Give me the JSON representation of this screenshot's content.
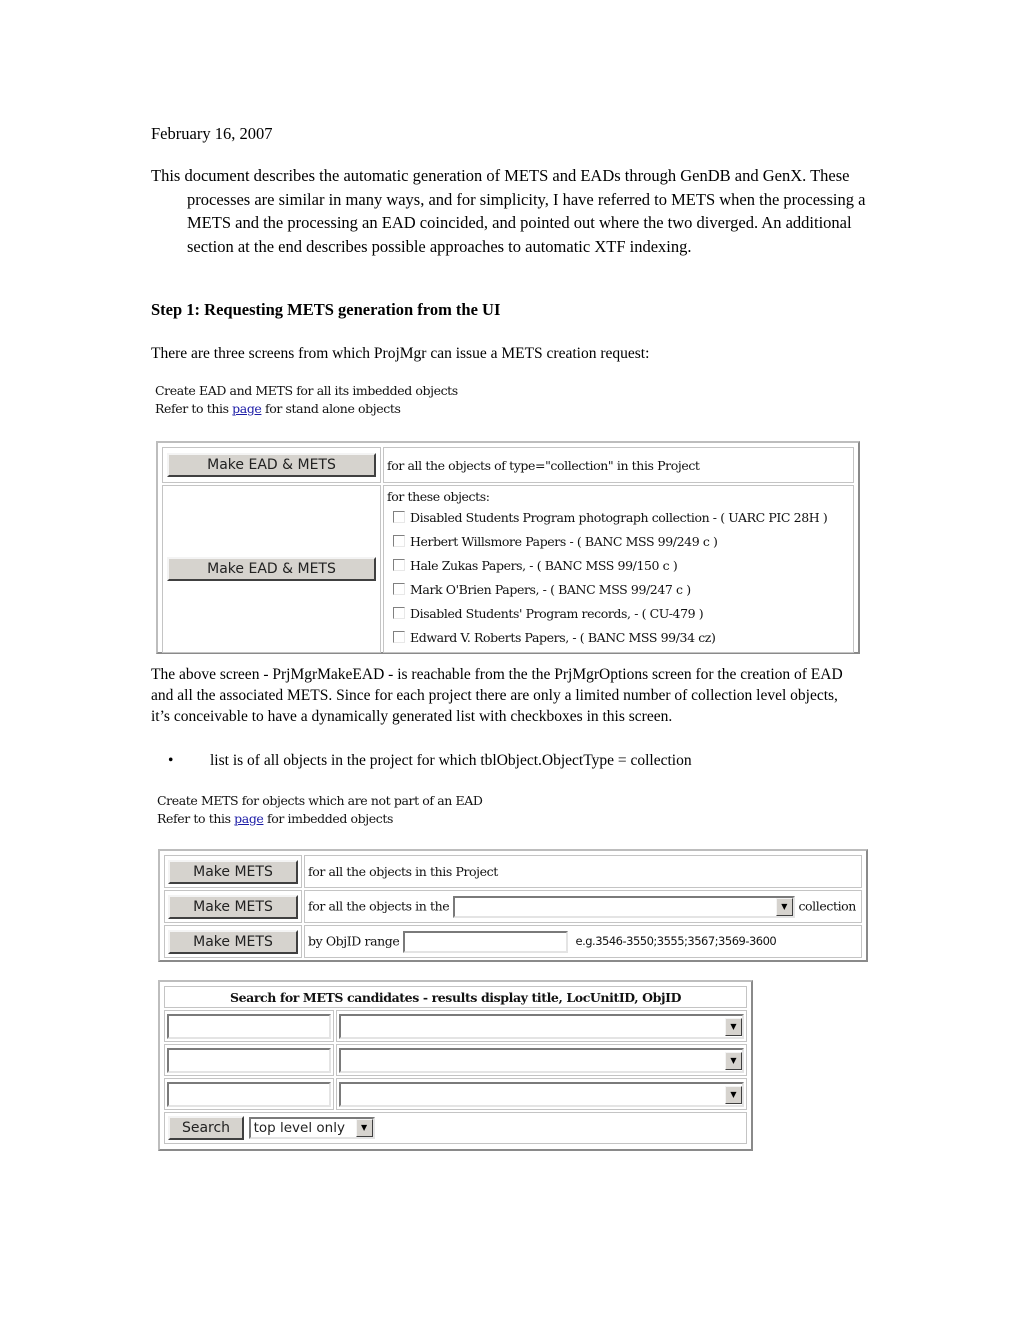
{
  "document": {
    "date": "February 16, 2007",
    "intro": "This document describes the automatic generation of METS and EADs through GenDB and GenX. These processes are similar in many ways, and for simplicity, I have referred to METS when the processing a METS and the processing an EAD coincided, and pointed out where the two diverged. An additional section at the end describes possible approaches to automatic XTF indexing.",
    "step1_heading": "Step 1: Requesting METS generation from the UI",
    "three_screens": "There are three screens from which ProjMgr can issue a METS creation request:",
    "above_screen": "The above screen - PrjMgrMakeEAD - is reachable from the the PrjMgrOptions screen for the creation of EAD and all the associated METS. Since for each project there are only a limited number of collection level objects, it’s conceivable to have a dynamically generated list with checkboxes in this screen.",
    "bullet": "list is of all objects in the project for which tblObject.ObjectType = collection",
    "bullet_glyph": "•"
  },
  "screen1": {
    "note_line1": "Create EAD and METS for all its imbedded objects",
    "note_prefix": "Refer to this ",
    "note_link": "page",
    "note_suffix": " for stand alone objects",
    "button_all": "Make EAD & METS",
    "desc_all": "for all the objects of type=\"collection\" in this Project",
    "button_selected": "Make EAD & METS",
    "desc_selected": "for these objects:",
    "objects": [
      {
        "label": "Disabled Students Program photograph collection - ( UARC PIC 28H )",
        "checked": false
      },
      {
        "label": "Herbert Willsmore Papers - ( BANC MSS 99/249 c )",
        "checked": false
      },
      {
        "label": "Hale Zukas Papers, - ( BANC MSS 99/150 c )",
        "checked": false
      },
      {
        "label": "Mark O'Brien Papers, - ( BANC MSS 99/247 c )",
        "checked": false
      },
      {
        "label": "Disabled Students' Program records, - ( CU-479 )",
        "checked": false
      },
      {
        "label": "Edward V. Roberts Papers, - ( BANC MSS 99/34 cz)",
        "checked": false
      }
    ]
  },
  "screen2": {
    "note_line1": "Create METS for objects which are not part of an EAD",
    "note_prefix": "Refer to this ",
    "note_link": "page",
    "note_suffix": " for imbedded objects",
    "rows": [
      {
        "button": "Make METS",
        "text": "for all the objects in this Project"
      },
      {
        "button": "Make METS",
        "text_before": "for all the objects in the",
        "select_value": "",
        "text_after": "collection"
      },
      {
        "button": "Make METS",
        "text_before": "by ObjID range",
        "input_value": "",
        "hint": "e.g.3546-3550;3555;3567;3569-3600"
      }
    ]
  },
  "screen3": {
    "header": "Search for METS candidates - results display title, LocUnitID, ObjID",
    "criteria": [
      {
        "input_value": "",
        "select_value": ""
      },
      {
        "input_value": "",
        "select_value": ""
      },
      {
        "input_value": "",
        "select_value": ""
      }
    ],
    "search_button": "Search",
    "level_select": "top level only",
    "dropdown_glyph": "▼"
  }
}
